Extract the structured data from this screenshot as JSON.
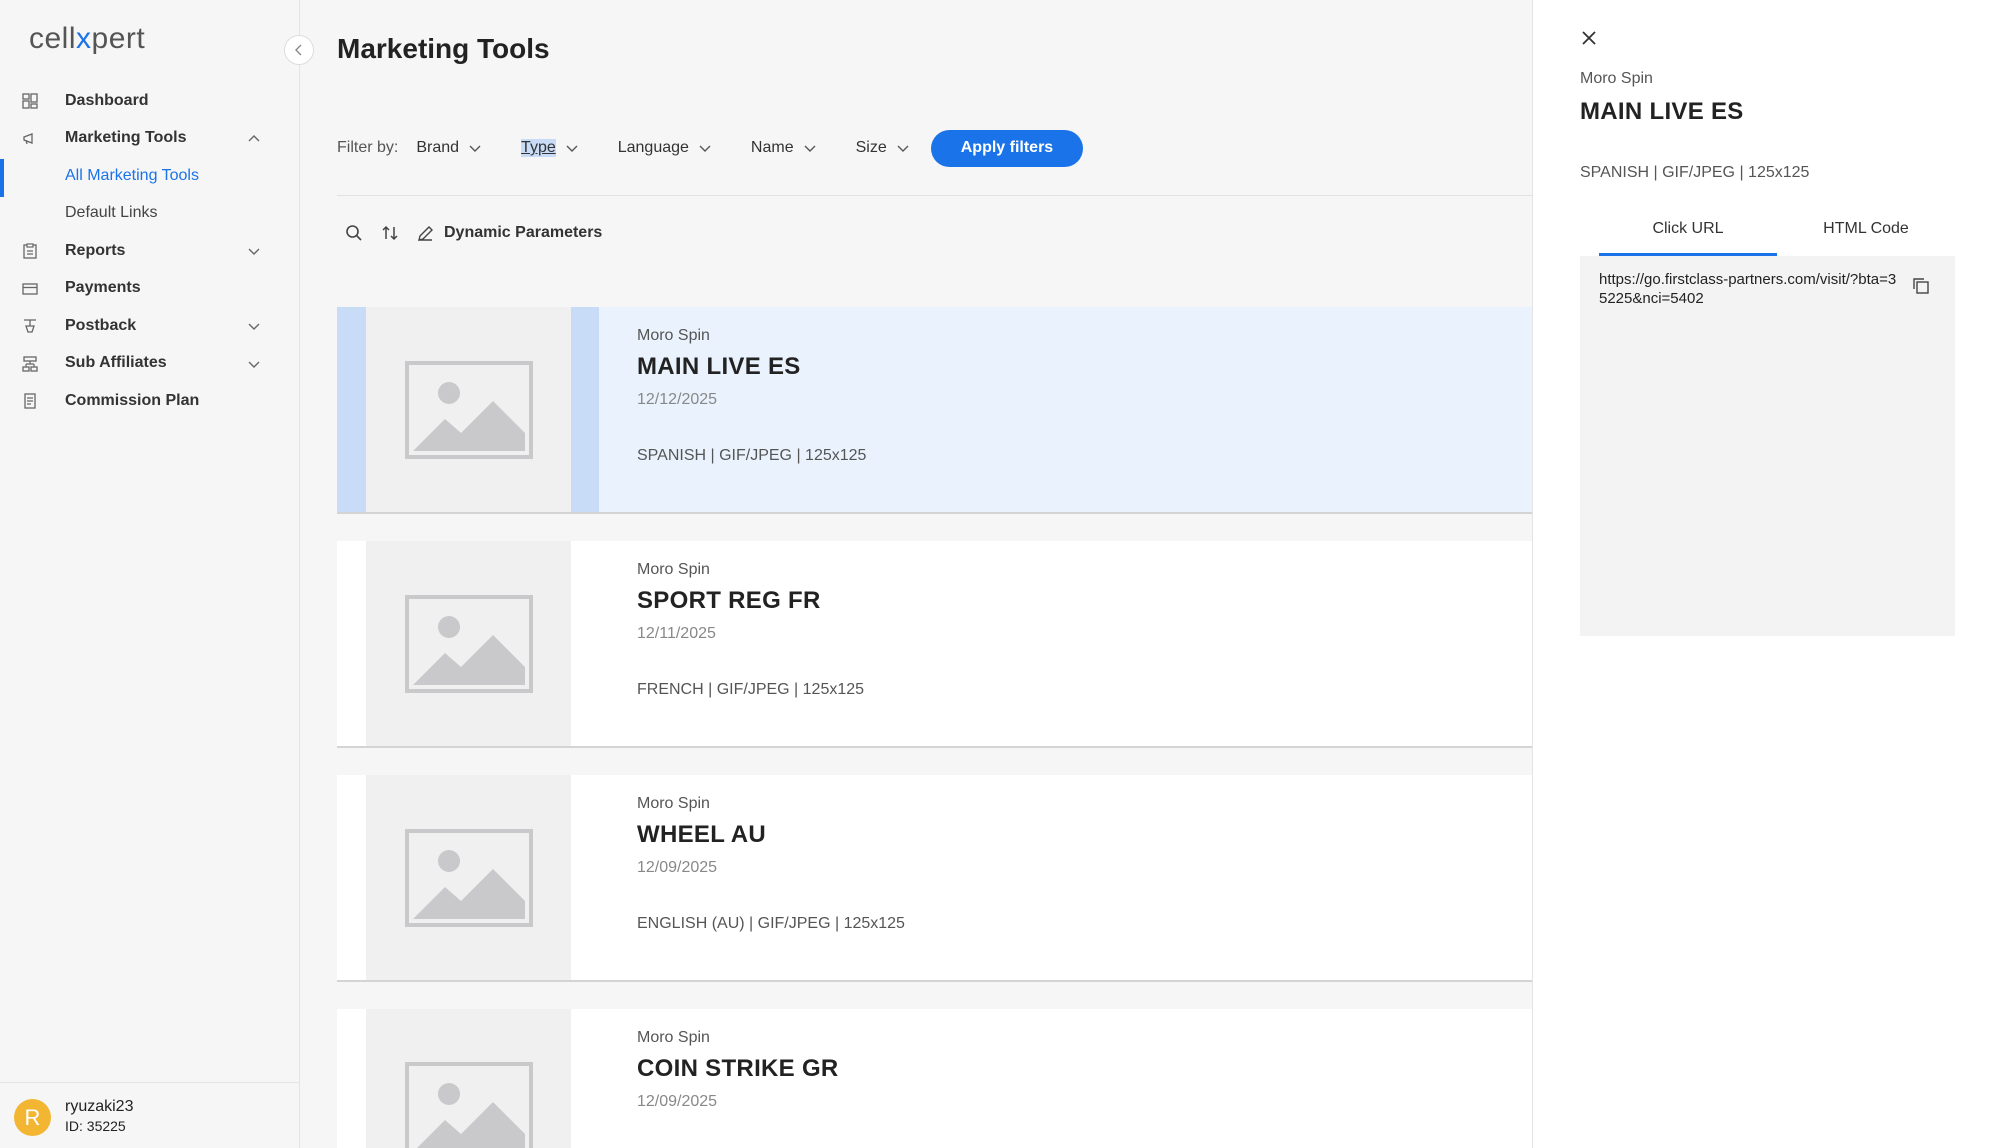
{
  "app": {
    "logo_pre": "cell",
    "logo_x": "x",
    "logo_post": "pert",
    "accent": "#1a73e8"
  },
  "sidebar": {
    "items": [
      {
        "label": "Dashboard",
        "icon": "dashboard-icon"
      },
      {
        "label": "Marketing Tools",
        "icon": "megaphone-icon",
        "expanded": true
      },
      {
        "label": "All Marketing Tools",
        "sub": true,
        "active": true
      },
      {
        "label": "Default Links",
        "sub": true
      },
      {
        "label": "Reports",
        "icon": "clipboard-icon"
      },
      {
        "label": "Payments",
        "icon": "card-icon"
      },
      {
        "label": "Postback",
        "icon": "postback-icon"
      },
      {
        "label": "Sub Affiliates",
        "icon": "network-icon"
      },
      {
        "label": "Commission Plan",
        "icon": "document-icon"
      }
    ]
  },
  "user": {
    "initial": "R",
    "name": "ryuzaki23",
    "id": "ID: 35225"
  },
  "main": {
    "title": "Marketing Tools",
    "filter_label": "Filter by:",
    "filters": [
      "Brand",
      "Type",
      "Language",
      "Name",
      "Size"
    ],
    "apply_label": "Apply filters",
    "dynamic_params_label": "Dynamic Parameters"
  },
  "cards": [
    {
      "brand": "Moro Spin",
      "name": "MAIN LIVE ES",
      "date": "12/12/2025",
      "meta": "SPANISH | GIF/JPEG | 125x125"
    },
    {
      "brand": "Moro Spin",
      "name": "SPORT REG FR",
      "date": "12/11/2025",
      "meta": "FRENCH | GIF/JPEG | 125x125"
    },
    {
      "brand": "Moro Spin",
      "name": "WHEEL AU",
      "date": "12/09/2025",
      "meta": "ENGLISH (AU) | GIF/JPEG | 125x125"
    },
    {
      "brand": "Moro Spin",
      "name": "COIN STRIKE GR",
      "date": "12/09/2025",
      "meta": ""
    }
  ],
  "panel": {
    "brand": "Moro Spin",
    "name": "MAIN LIVE ES",
    "meta": "SPANISH | GIF/JPEG | 125x125",
    "tabs": [
      "Click URL",
      "HTML Code"
    ],
    "url": "https://go.firstclass-partners.com/visit/?bta=35225&nci=5402"
  }
}
